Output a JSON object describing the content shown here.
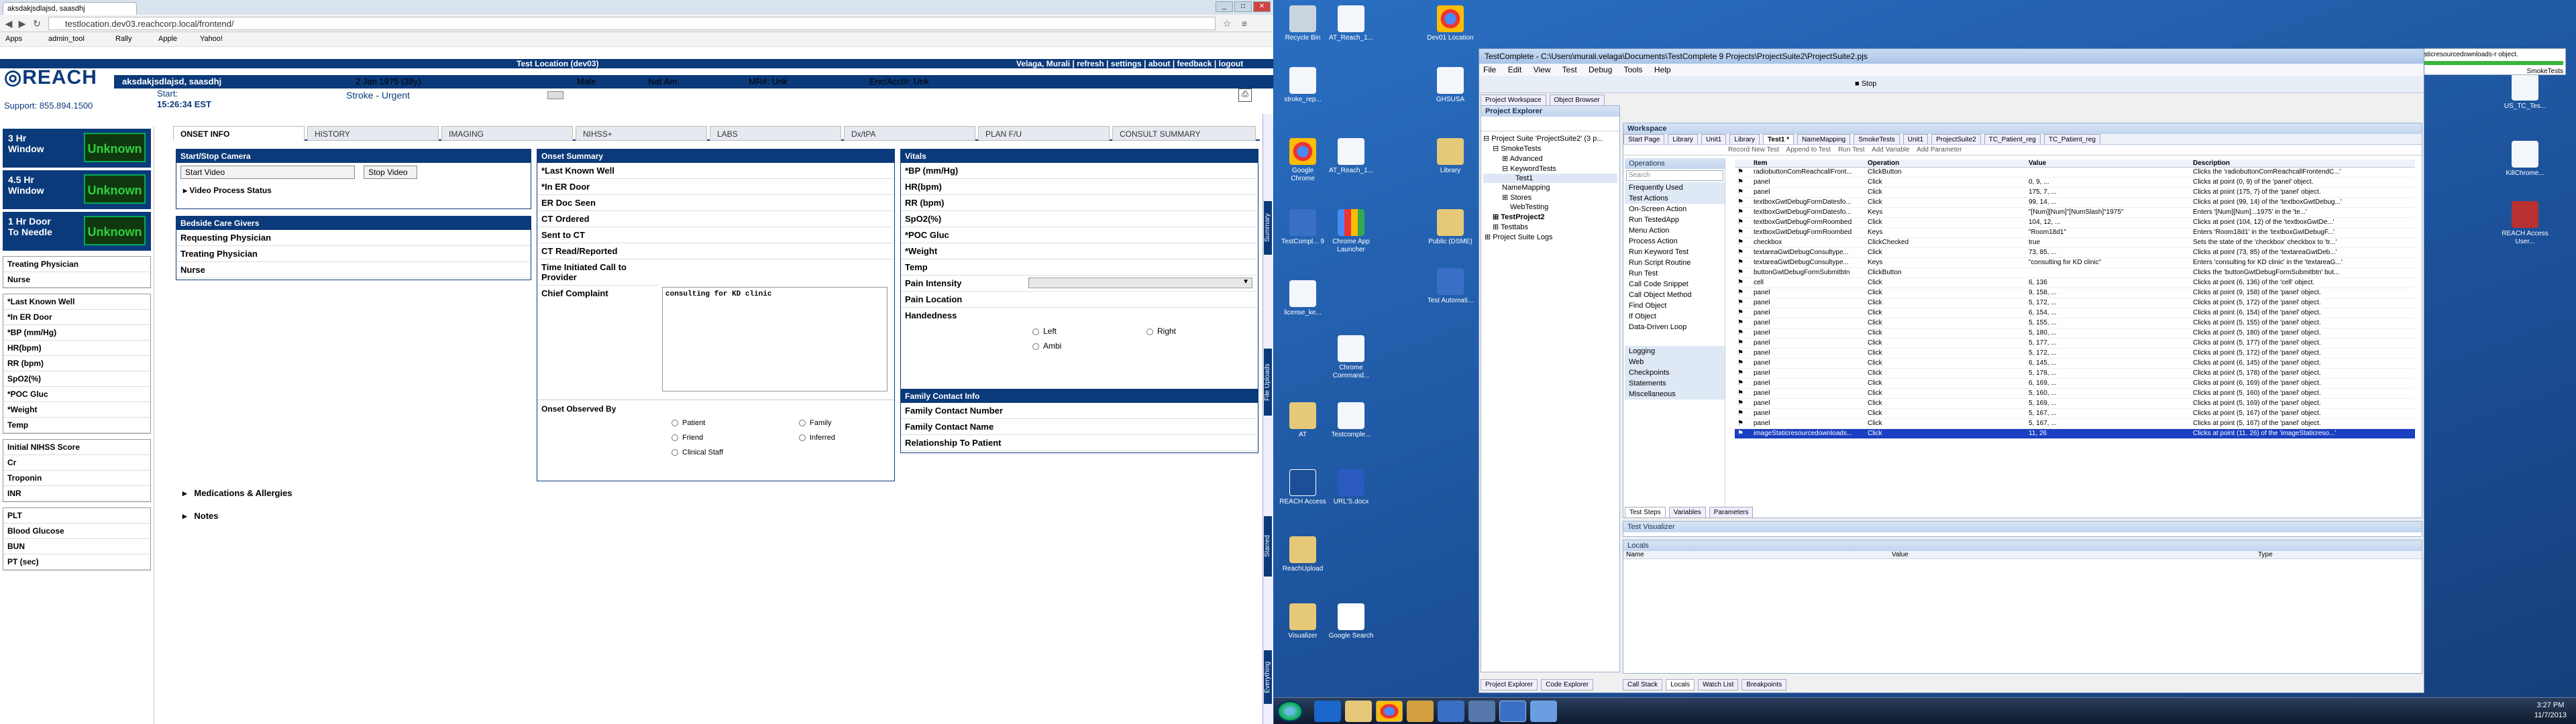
{
  "browser": {
    "tab_title": "aksdakjsdlajsd, saasdhj",
    "url": "testlocation.dev03.reachcorp.local/frontend/",
    "bookmarks": [
      "Apps",
      "admin_tool",
      "Rally",
      "Apple",
      "Yahoo!"
    ]
  },
  "app": {
    "logo": "REACH",
    "support": "Support: 855.894.1500",
    "location": "Test Location (dev03)",
    "user_links": [
      "Velaga, Murali",
      "refresh",
      "settings",
      "about",
      "feedback",
      "logout"
    ],
    "patient": {
      "name": "aksdakjsdlajsd, saasdhj",
      "dob": "2 Jan 1975 (38y)",
      "sex": "Male",
      "nat_am": "Nat.Am.",
      "mr": "MR#: Unk",
      "enc": "Enc/Acct#: Unk",
      "room": "Room/Bed: Room18d1",
      "start_label": "Start:",
      "start_time": "15:26:34 EST",
      "stroke": "Stroke - Urgent"
    },
    "windows": [
      {
        "label": "3 Hr Window",
        "value": "Unknown"
      },
      {
        "label": "4.5 Hr Window",
        "value": "Unknown"
      },
      {
        "label": "1 Hr Door To Needle",
        "value": "Unknown"
      }
    ],
    "left_groups": [
      [
        "Treating Physician",
        "Nurse"
      ],
      [
        "*Last Known Well",
        "*In ER Door",
        "*BP (mm/Hg)",
        "HR(bpm)",
        "RR (bpm)",
        "SpO2(%)",
        "*POC Gluc",
        "*Weight",
        "Temp"
      ],
      [
        "Initial NIHSS Score",
        "Cr",
        "Troponin",
        "INR"
      ],
      [
        "PLT",
        "Blood Glucose",
        "BUN",
        "PT (sec)"
      ]
    ],
    "tabs": [
      "ONSET INFO",
      "HISTORY",
      "IMAGING",
      "NIHSS+",
      "LABS",
      "Dx/tPA",
      "PLAN F/U",
      "CONSULT SUMMARY"
    ],
    "camera": {
      "title": "Start/Stop Camera",
      "start": "Start Video",
      "stop": "Stop Video",
      "status": "Video Process Status"
    },
    "caregivers": {
      "title": "Bedside Care Givers",
      "rows": [
        "Requesting Physician",
        "Treating Physician",
        "Nurse"
      ]
    },
    "onset": {
      "title": "Onset Summary",
      "rows": [
        "*Last Known Well",
        "*In ER Door",
        "ER Doc Seen",
        "CT Ordered",
        "Sent to CT",
        "CT Read/Reported",
        "Time Initiated Call to Provider"
      ],
      "complaint_label": "Chief Complaint",
      "complaint_value": "consulting for KD clinic",
      "observed_label": "Onset Observed By",
      "observed_options": [
        "Patient",
        "Family",
        "Friend",
        "Inferred",
        "Clinical Staff"
      ]
    },
    "vitals": {
      "title": "Vitals",
      "rows": [
        "*BP (mm/Hg)",
        "HR(bpm)",
        "RR (bpm)",
        "SpO2(%)",
        "*POC Gluc",
        "*Weight",
        "Temp",
        "Pain Intensity",
        "Pain Location"
      ],
      "handedness_label": "Handedness",
      "handedness": [
        "Left",
        "Right",
        "Ambi"
      ]
    },
    "family": {
      "title": "Family Contact Info",
      "rows": [
        "Family Contact Name",
        "Family Contact Number",
        "Relationship To Patient"
      ]
    },
    "expanders": [
      "Medications & Allergies",
      "Notes"
    ],
    "side_tabs": [
      "Summary",
      "File Uploads",
      "Starred",
      "Everything"
    ]
  },
  "desktop": {
    "icons": [
      "Recycle Bin",
      "AT_Reach_1...",
      "Dev01 Location",
      "stroke_rep...",
      "GHSUSA",
      "Google Chrome",
      "AT_Reach_1...",
      "Library",
      "TestCompl... 9",
      "Chrome App Launcher",
      "Public (DSME)",
      "license_ke...",
      "Test Automati...",
      "Chrome Command...",
      "AT",
      "Testcomple...",
      "REACH Access",
      "URL'S.docx",
      "ReachUpload",
      "Visualizer",
      "Google Search",
      "US_TC_Tes...",
      "KillChrome...",
      "REACH Access User..."
    ],
    "clock_time": "3:27 PM",
    "clock_date": "11/7/2013"
  },
  "testcomplete": {
    "title": "TestComplete - C:\\Users\\murali.velaga\\Documents\\TestComplete 9 Projects\\ProjectSuite2\\ProjectSuite2.pjs",
    "menu": [
      "File",
      "Edit",
      "View",
      "Test",
      "Debug",
      "Tools",
      "Help"
    ],
    "stop_label": "Stop",
    "left_tabs": [
      "Project Workspace",
      "Object Browser"
    ],
    "explorer_title": "Project Explorer",
    "tree": [
      "Project Suite 'ProjectSuite2' (3 p...",
      "SmokeTests",
      "Advanced",
      "KeywordTests",
      "Test1",
      "NameMapping",
      "Stores",
      "WebTesting",
      "TestProject2",
      "Testtabs",
      "Project Suite Logs"
    ],
    "bottom_left_tabs": [
      "Project Explorer",
      "Code Explorer"
    ],
    "workspace_title": "Workspace",
    "doc_tabs": [
      "Start Page",
      "Library",
      "Unit1",
      "Library",
      "Test1 *",
      "NameMapping",
      "SmokeTests",
      "Unit1",
      "ProjectSuite2",
      "TC_Patient_reg",
      "TC_Patient_reg"
    ],
    "actions": [
      "Record New Test",
      "Append to Test",
      "Run Test",
      "Add Variable",
      "Add Parameter"
    ],
    "operations_title": "Operations",
    "search_placeholder": "Search",
    "operations": [
      "Frequently Used",
      "Test Actions",
      "On-Screen Action",
      "Run TestedApp",
      "Menu Action",
      "Process Action",
      "Run Keyword Test",
      "Run Script Routine",
      "Run Test",
      "Call Code Snippet",
      "Call Object Method",
      "Find Object",
      "If Object",
      "Data-Driven Loop",
      "Logging",
      "Web",
      "Checkpoints",
      "Statements",
      "Miscellaneous"
    ],
    "columns": [
      "Item",
      "Operation",
      "Value",
      "Description"
    ],
    "steps": [
      [
        "radiobuttonComReachcallFront...",
        "ClickButton",
        "",
        "Clicks the 'radiobuttonComReachcallFrontendC...'"
      ],
      [
        "panel",
        "Click",
        "0, 9, ...",
        "Clicks at point (0, 9) of the 'panel' object."
      ],
      [
        "panel",
        "Click",
        "175, 7, ...",
        "Clicks at point (175, 7) of the 'panel' object."
      ],
      [
        "textboxGwtDebugFormDatesfo...",
        "Click",
        "99, 14, ...",
        "Clicks at point (99, 14) of the 'textboxGwtDebug...'"
      ],
      [
        "textboxGwtDebugFormDatesfo...",
        "Keys",
        "\"[Num][Num]\"[NumSlash]\"1975\"",
        "Enters '[Num][Num]...1975' in the 'te...'"
      ],
      [
        "textboxGwtDebugFormRoombed",
        "Click",
        "104, 12, ...",
        "Clicks at point (104, 12) of the 'textboxGwtDe...'"
      ],
      [
        "textboxGwtDebugFormRoombed",
        "Keys",
        "\"Room18d1\"",
        "Enters 'Room18d1' in the 'textboxGwtDebugF...'"
      ],
      [
        "checkbox",
        "ClickChecked",
        "true",
        "Sets the state of the 'checkbox' checkbox to 'tr...'"
      ],
      [
        "textareaGwtDebugConsultype...",
        "Click",
        "73, 85, ...",
        "Clicks at point (73, 85) of the 'textareaGwtDeb...'"
      ],
      [
        "textareaGwtDebugConsultype...",
        "Keys",
        "\"consulting for KD clinic\"",
        "Enters 'consulting for KD clinic' in the 'textareaG...'"
      ],
      [
        "buttonGwtDebugFormSubmitbtn",
        "ClickButton",
        "",
        "Clicks the 'buttonGwtDebugFormSubmitbtn' but..."
      ],
      [
        "cell",
        "Click",
        "6, 136",
        "Clicks at point (6, 136) of the 'cell' object."
      ],
      [
        "panel",
        "Click",
        "9, 158, ...",
        "Clicks at point (9, 158) of the 'panel' object."
      ],
      [
        "panel",
        "Click",
        "5, 172, ...",
        "Clicks at point (5, 172) of the 'panel' object."
      ],
      [
        "panel",
        "Click",
        "6, 154, ...",
        "Clicks at point (6, 154) of the 'panel' object."
      ],
      [
        "panel",
        "Click",
        "5, 155, ...",
        "Clicks at point (5, 155) of the 'panel' object."
      ],
      [
        "panel",
        "Click",
        "5, 180, ...",
        "Clicks at point (5, 180) of the 'panel' object."
      ],
      [
        "panel",
        "Click",
        "5, 177, ...",
        "Clicks at point (5, 177) of the 'panel' object."
      ],
      [
        "panel",
        "Click",
        "5, 172, ...",
        "Clicks at point (5, 172) of the 'panel' object."
      ],
      [
        "panel",
        "Click",
        "6, 145, ...",
        "Clicks at point (6, 145) of the 'panel' object."
      ],
      [
        "panel",
        "Click",
        "5, 178, ...",
        "Clicks at point (5, 178) of the 'panel' object."
      ],
      [
        "panel",
        "Click",
        "6, 169, ...",
        "Clicks at point (6, 169) of the 'panel' object."
      ],
      [
        "panel",
        "Click",
        "5, 160, ...",
        "Clicks at point (5, 160) of the 'panel' object."
      ],
      [
        "panel",
        "Click",
        "5, 169, ...",
        "Clicks at point (5, 169) of the 'panel' object."
      ],
      [
        "panel",
        "Click",
        "5, 167, ...",
        "Clicks at point (5, 167) of the 'panel' object."
      ],
      [
        "panel",
        "Click",
        "5, 167, ...",
        "Clicks at point (5, 167) of the 'panel' object."
      ],
      [
        "imageStaticresourcedownloads...",
        "Click",
        "11, 26",
        "Clicks at point (11, 26) of the 'imageStaticreso...'"
      ]
    ],
    "step_tabs": [
      "Test Steps",
      "Variables",
      "Parameters"
    ],
    "visualizer_title": "Test Visualizer",
    "locals_title": "Locals",
    "locals_cols": [
      "Name",
      "Value",
      "Type"
    ],
    "bottom_tabs": [
      "Call Stack",
      "Locals",
      "Watch List",
      "Breakpoints"
    ]
  },
  "wait": {
    "text": "Waiting for the imageStaticresourcedownloads-r object.",
    "title": "SmokeTests"
  }
}
